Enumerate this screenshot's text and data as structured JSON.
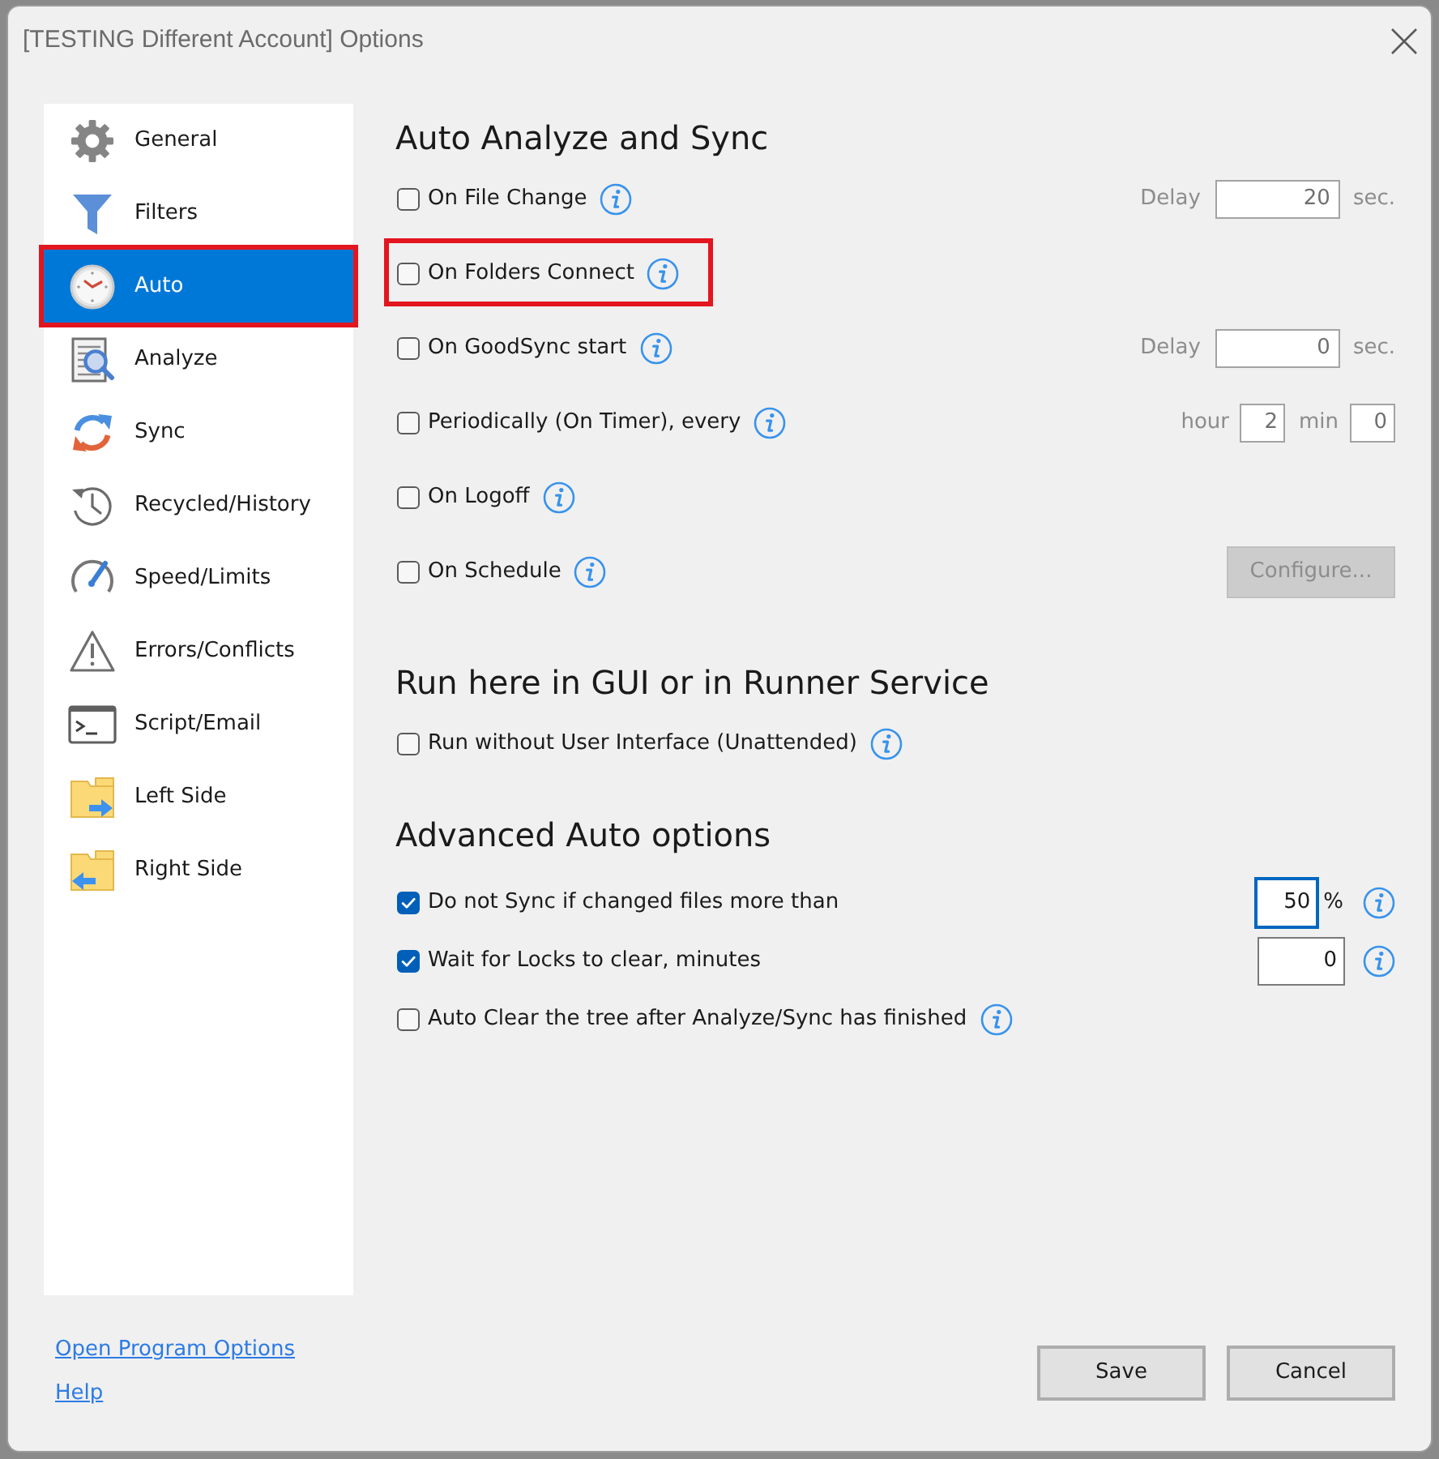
{
  "window": {
    "title": "[TESTING Different Account] Options"
  },
  "sidebar": {
    "items": [
      {
        "label": "General",
        "selected": false,
        "highlighted": false
      },
      {
        "label": "Filters",
        "selected": false,
        "highlighted": false
      },
      {
        "label": "Auto",
        "selected": true,
        "highlighted": true
      },
      {
        "label": "Analyze",
        "selected": false,
        "highlighted": false
      },
      {
        "label": "Sync",
        "selected": false,
        "highlighted": false
      },
      {
        "label": "Recycled/History",
        "selected": false,
        "highlighted": false
      },
      {
        "label": "Speed/Limits",
        "selected": false,
        "highlighted": false
      },
      {
        "label": "Errors/Conflicts",
        "selected": false,
        "highlighted": false
      },
      {
        "label": "Script/Email",
        "selected": false,
        "highlighted": false
      },
      {
        "label": "Left Side",
        "selected": false,
        "highlighted": false
      },
      {
        "label": "Right Side",
        "selected": false,
        "highlighted": false
      }
    ]
  },
  "sections": [
    {
      "heading": "Auto Analyze and Sync",
      "options": [
        {
          "kind": "delay",
          "label": "On File Change",
          "checked": false,
          "highlighted": false,
          "control": {
            "label": "Delay",
            "value": "20",
            "unit": "sec.",
            "disabled": true
          }
        },
        {
          "kind": "plain",
          "label": "On Folders Connect",
          "checked": false,
          "highlighted": true
        },
        {
          "kind": "delay",
          "label": "On GoodSync start",
          "checked": false,
          "highlighted": false,
          "control": {
            "label": "Delay",
            "value": "0",
            "unit": "sec.",
            "disabled": true
          }
        },
        {
          "kind": "timer",
          "label": "Periodically (On Timer), every",
          "checked": false,
          "highlighted": false,
          "control": {
            "fields": [
              {
                "label": "hour",
                "value": "2"
              },
              {
                "label": "min",
                "value": "0"
              }
            ],
            "disabled": true
          }
        },
        {
          "kind": "plain",
          "label": "On Logoff",
          "checked": false,
          "highlighted": false
        },
        {
          "kind": "button",
          "label": "On Schedule",
          "checked": false,
          "highlighted": false,
          "control": {
            "label": "Configure...",
            "disabled": true
          }
        }
      ]
    },
    {
      "heading": "Run here in GUI or in Runner Service",
      "options": [
        {
          "kind": "plain",
          "label": "Run without User Interface (Unattended)",
          "checked": false,
          "highlighted": false
        }
      ]
    },
    {
      "heading": "Advanced Auto options",
      "options": [
        {
          "kind": "percent",
          "label": "Do not Sync if changed files more than",
          "checked": true,
          "highlighted": false,
          "control": {
            "value": "50",
            "unit": "%",
            "focused": true
          }
        },
        {
          "kind": "number",
          "label": "Wait for Locks to clear, minutes",
          "checked": true,
          "highlighted": false,
          "control": {
            "value": "0",
            "focused": false
          }
        },
        {
          "kind": "plain",
          "label": "Auto Clear the tree after Analyze/Sync has finished",
          "checked": false,
          "highlighted": false
        }
      ]
    }
  ],
  "footer": {
    "links": [
      "Open Program Options",
      "Help"
    ],
    "buttons": [
      "Save",
      "Cancel"
    ]
  }
}
